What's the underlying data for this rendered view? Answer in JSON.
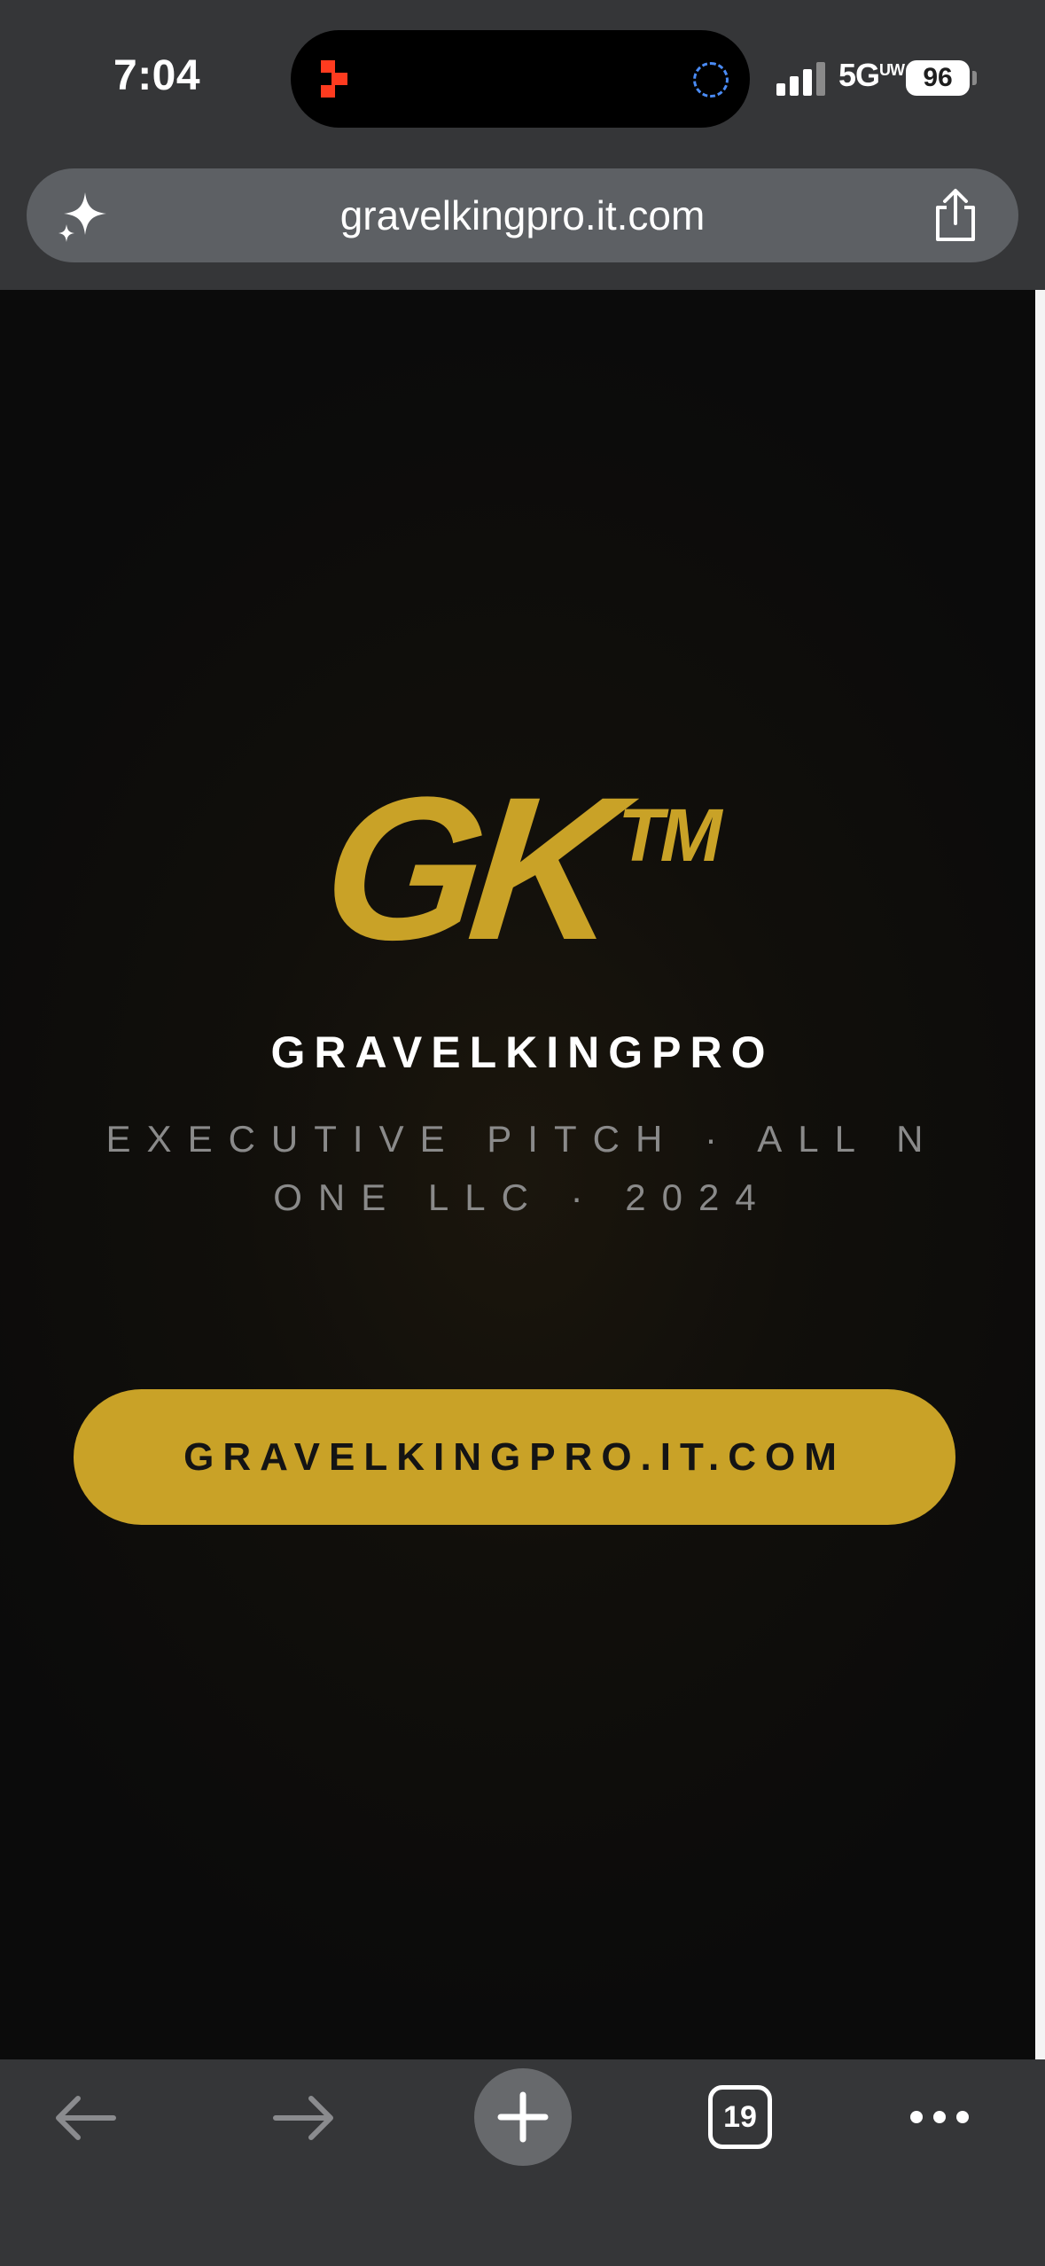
{
  "status_bar": {
    "time": "7:04",
    "network": "5G",
    "network_suffix": "UW",
    "battery": "96",
    "icons": [
      "app-activity-icon",
      "dynamic-island-activity-icon",
      "cellular-signal-icon",
      "battery-icon"
    ]
  },
  "browser": {
    "url": "gravelkingpro.it.com",
    "tab_count": "19",
    "icons": [
      "sparkle-icon",
      "share-icon",
      "back-arrow-icon",
      "forward-arrow-icon",
      "plus-icon",
      "more-icon"
    ]
  },
  "page": {
    "logo_mark": "GK",
    "logo_tm": "TM",
    "brand_name": "GRAVELKINGPRO",
    "tagline": "EXECUTIVE PITCH · ALL N ONE LLC · 2024",
    "cta_label": "GRAVELKINGPRO.IT.COM"
  },
  "colors": {
    "accent_gold": "#c9a227",
    "page_background": "#0b0b0b",
    "chrome_background": "#353638",
    "address_bar": "#5d6064",
    "tagline_gray": "#8a8a8a"
  }
}
